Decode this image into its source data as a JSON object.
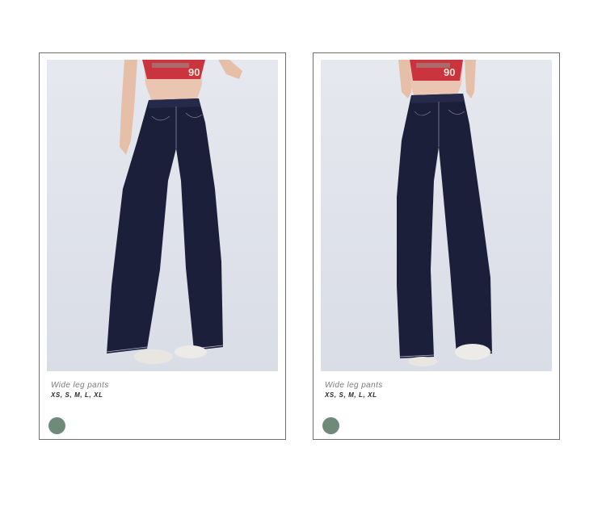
{
  "products": [
    {
      "caption": "Wide leg pants",
      "sizes": "XS, S, M, L, XL",
      "swatch_color": "#6f8a78"
    },
    {
      "caption": "Wide leg pants",
      "sizes": "XS, S, M, L, XL",
      "swatch_color": "#6f8a78"
    }
  ],
  "top_print_text": "90",
  "denim_color": "#1c1f3a",
  "top_color": "#c9343e"
}
